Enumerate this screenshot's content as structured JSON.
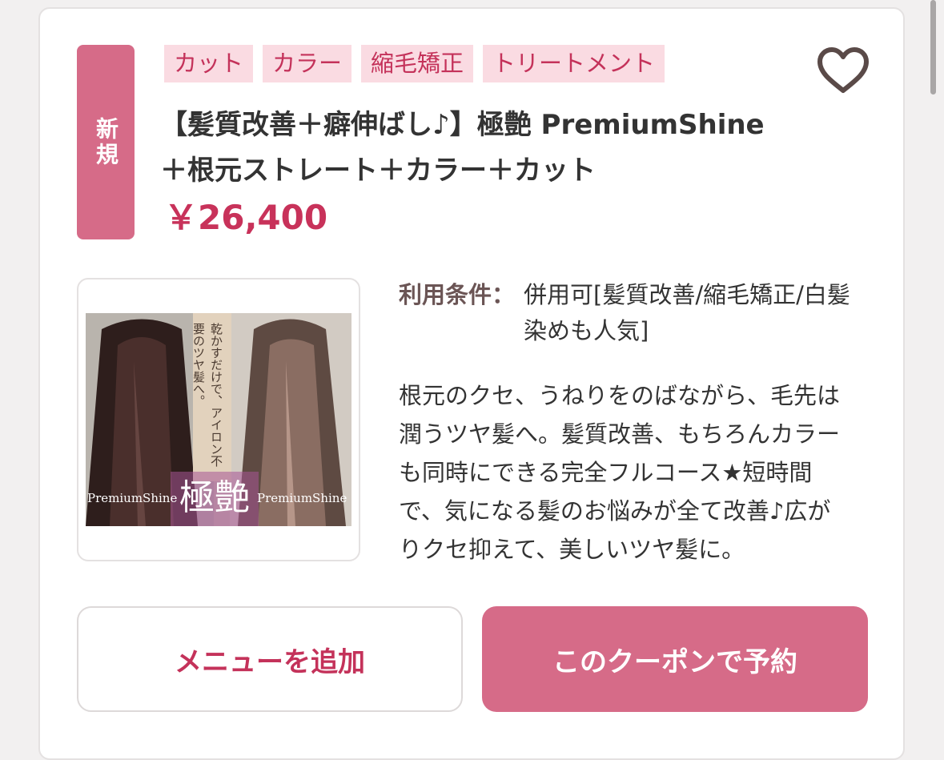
{
  "coupon": {
    "badge": "新規",
    "tags": [
      "カット",
      "カラー",
      "縮毛矯正",
      "トリートメント"
    ],
    "title": "【髪質改善＋癖伸ばし♪】極艶 PremiumShine\n＋根元ストレート＋カラー＋カット",
    "price": "￥26,400",
    "image": {
      "caption": "乾かすだけで、アイロン不要のツヤ髪へ。",
      "logo": "極艶",
      "brand_left": "PremiumShine",
      "brand_right": "PremiumShine"
    },
    "conditions_label": "利用条件：",
    "conditions_value": "併用可[髪質改善/縮毛矯正/白髪染めも人気]",
    "description": "根元のクセ、うねりをのばながら、毛先は潤うツヤ髪へ。髪質改善、もちろんカラーも同時にできる完全フルコース★短時間で、気になる髪のお悩みが全て改善♪広がりクセ抑えて、美しいツヤ髪に。",
    "add_menu_label": "メニューを追加",
    "reserve_label": "このクーポンで予約"
  },
  "colors": {
    "accent": "#d66b88",
    "price": "#c8325a",
    "tag_bg": "#fadbe2"
  }
}
